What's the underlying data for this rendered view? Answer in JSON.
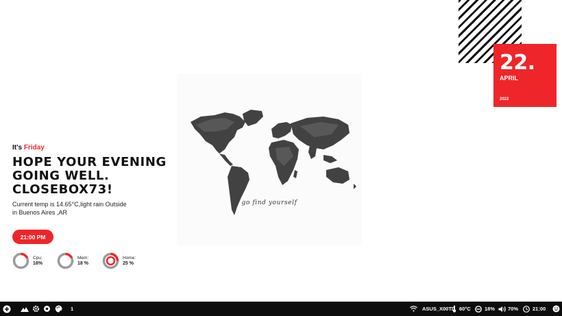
{
  "date": {
    "day": "22.",
    "month": "APRIL",
    "year": "2022"
  },
  "map": {
    "caption": "go find yourself"
  },
  "greeting": {
    "prefix": "It's",
    "day": "Friday",
    "line1": "HOPE YOUR EVENING",
    "line2": "GOING WELL.",
    "line3": "CLOSEBOX73!",
    "weather_line1": "Current temp is 14.65°C,light rain Outside",
    "weather_line2": "in Buenos Aires ,AR"
  },
  "clock_pill": "21:00 PM",
  "stats": [
    {
      "label": "Cpu:",
      "value": "18%",
      "percent": 18
    },
    {
      "label": "Mem:",
      "value": "18 %",
      "percent": 18
    },
    {
      "label": "Home:",
      "value": "25 %",
      "percent": 25
    }
  ],
  "taskbar": {
    "workspace": "1",
    "wifi_name": "ASUS_X00TD",
    "temp": "60°C",
    "cpu": "18%",
    "volume": "70%",
    "time": "21:00"
  },
  "colors": {
    "accent": "#ee2629",
    "taskbar": "#0d0d0d"
  }
}
